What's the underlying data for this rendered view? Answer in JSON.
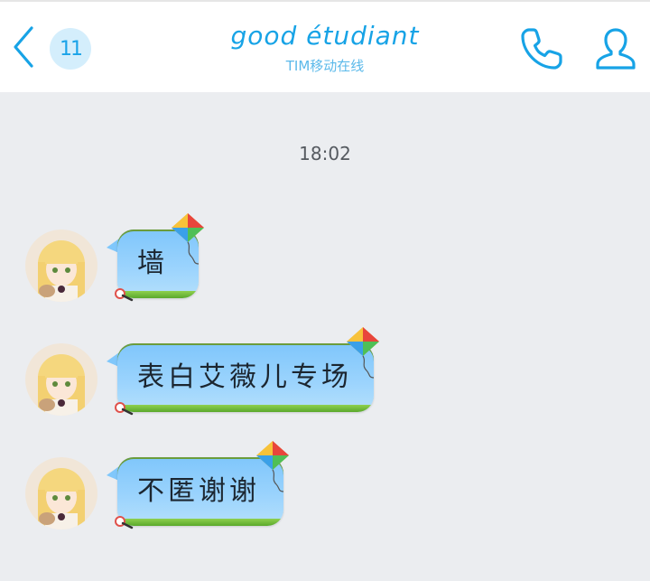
{
  "header": {
    "unread_count": "11",
    "title": "good étudiant",
    "subtitle": "TIM移动在线"
  },
  "chat": {
    "timestamp": "18:02",
    "messages": [
      {
        "text": "墙"
      },
      {
        "text": "表白艾薇儿专场"
      },
      {
        "text": "不匿谢谢"
      }
    ]
  },
  "colors": {
    "accent": "#17a3e6",
    "bubble_top": "#7fc6fb",
    "bubble_bottom": "#b5e0fc",
    "grass": "#5aa92c",
    "background": "#ebedf0"
  },
  "icons": {
    "back": "chevron-left-icon",
    "call": "phone-icon",
    "profile": "person-icon",
    "bubble_decor": "kite-icon"
  }
}
